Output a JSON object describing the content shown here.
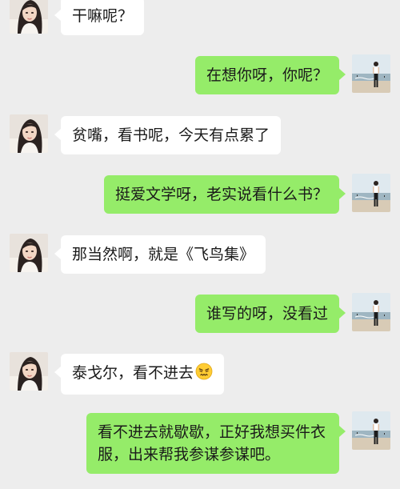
{
  "messages": [
    {
      "side": "in",
      "text": "干嘛呢？",
      "avatar": "female-avatar"
    },
    {
      "side": "out",
      "text": "在想你呀，你呢？",
      "avatar": "male-avatar-beach"
    },
    {
      "side": "in",
      "text": "贫嘴，看书呢，今天有点累了",
      "avatar": "female-avatar"
    },
    {
      "side": "out",
      "text": "挺爱文学呀，老实说看什么书？",
      "avatar": "male-avatar-beach"
    },
    {
      "side": "in",
      "text": "那当然啊，就是《飞鸟集》",
      "avatar": "female-avatar"
    },
    {
      "side": "out",
      "text": "谁写的呀，没看过",
      "avatar": "male-avatar-beach"
    },
    {
      "side": "in",
      "text": "泰戈尔，看不进去",
      "emoji": "persevering-face-emoji",
      "avatar": "female-avatar"
    },
    {
      "side": "out",
      "text": "看不进去就歇歇，正好我想买件衣服，出来帮我参谋参谋吧。",
      "avatar": "male-avatar-beach"
    }
  ],
  "colors": {
    "background": "#ededed",
    "incoming_bubble": "#ffffff",
    "outgoing_bubble": "#95ec69"
  }
}
